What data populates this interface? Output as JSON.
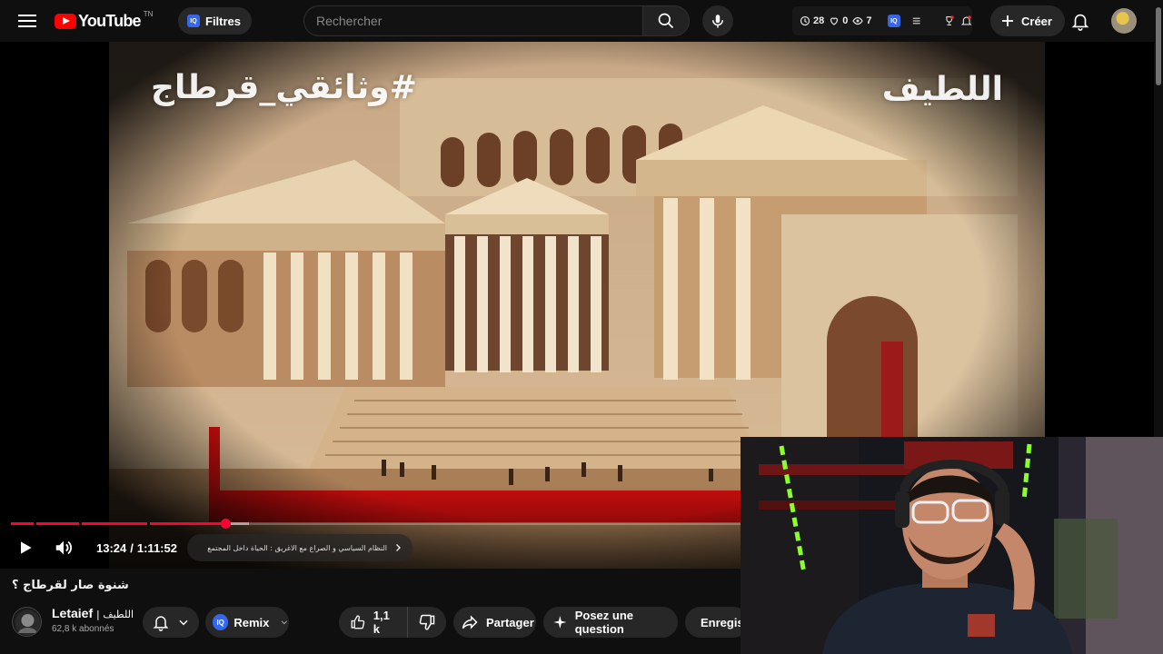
{
  "header": {
    "logo_text": "YouTube",
    "country_code": "TN",
    "filters_label": "Filtres",
    "filters_badge": "IQ",
    "search_placeholder": "Rechercher",
    "extension": {
      "watch_count": "28",
      "likes_count": "0",
      "views_count": "7",
      "badge": "IQ"
    },
    "create_label": "Créer"
  },
  "video": {
    "overlay_left_text": "#وثائقي_قرطاج",
    "overlay_right_text": "اللطيف",
    "progress": 0.19,
    "buffered": 0.21,
    "chapter_marks": [
      0.02,
      0.06,
      0.12
    ],
    "time_current": "13:24",
    "time_separator": "/",
    "time_total": "1:11:52",
    "chapter_text": "النظام السياسي و الصراع مع الاغريق : الحياة داخل المجتمع"
  },
  "info": {
    "title": "شنوة صار لقرطاج ؟",
    "channel_name": "Letaief",
    "channel_name_ar": "| اللطيف",
    "subscribers": "62,8 k abonnés",
    "remix_label": "Remix",
    "remix_badge": "IQ",
    "like_count": "1,1 k",
    "share_label": "Partager",
    "ask_label": "Posez une question",
    "save_label": "Enregistrer"
  },
  "colors": {
    "brand_red": "#ff0000",
    "progress_red": "#ff0033",
    "background": "#0f0f0f",
    "pill": "#272727",
    "iq_blue": "#3567e8"
  }
}
